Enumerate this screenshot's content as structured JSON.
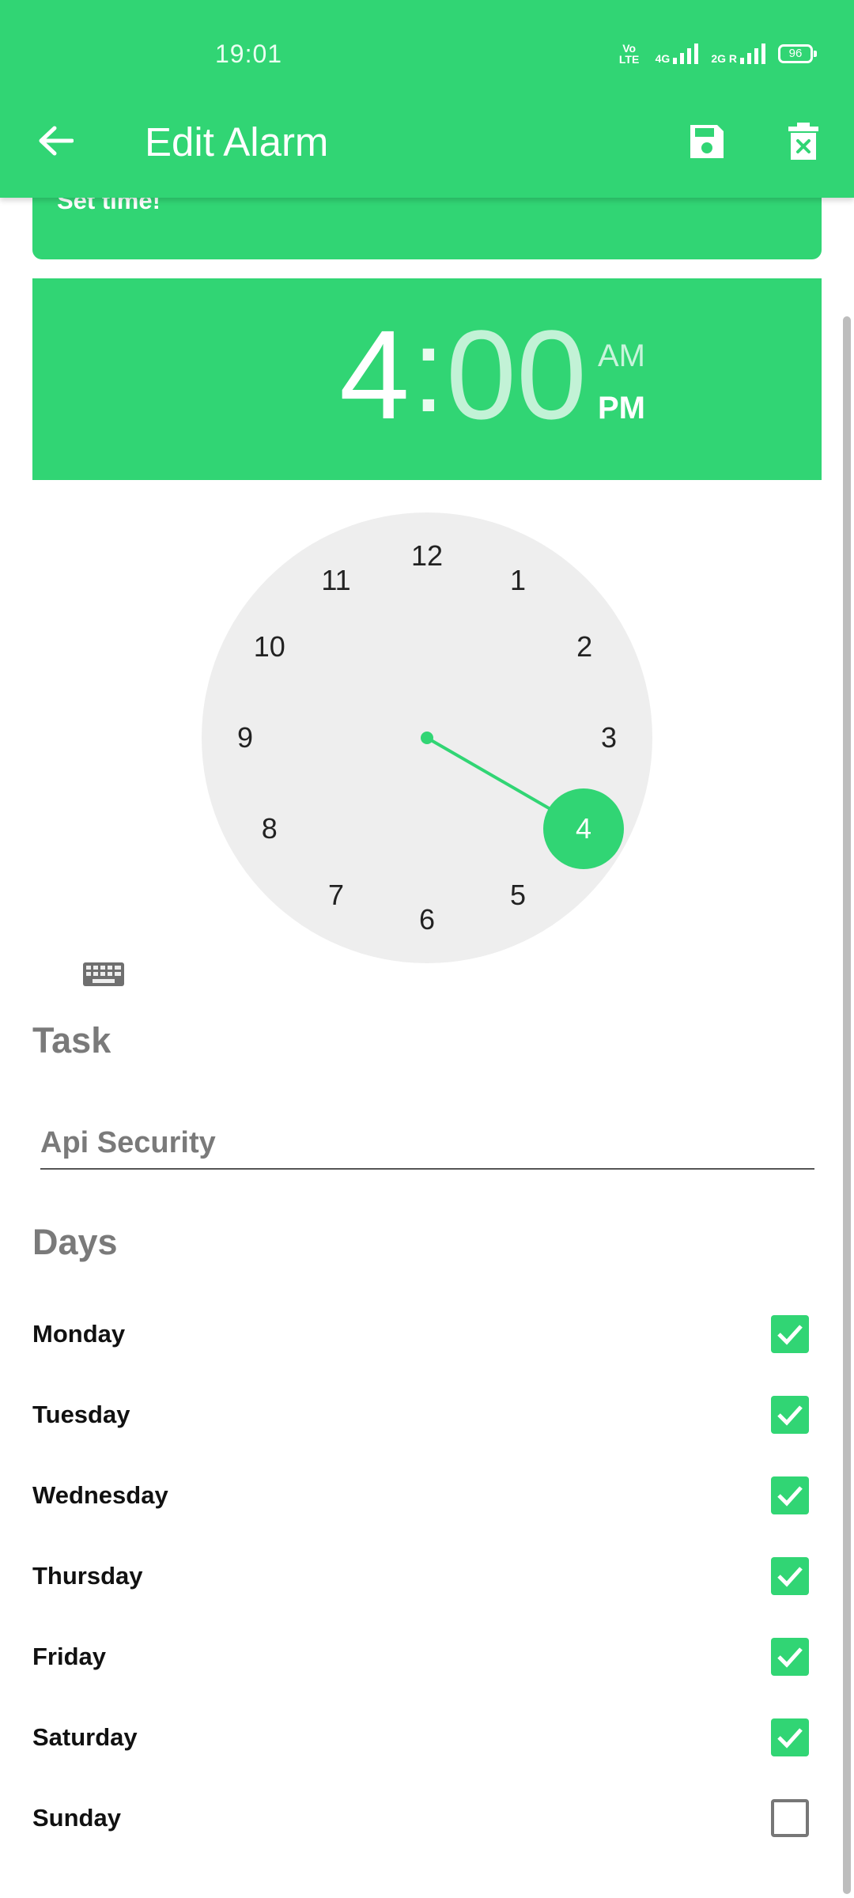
{
  "status_bar": {
    "time": "19:01",
    "volte": "Vo LTE",
    "net1": "4G",
    "net2": "2G R",
    "battery": "96"
  },
  "header": {
    "title": "Edit Alarm",
    "back_icon": "arrow-left-icon",
    "save_icon": "floppy-disk-icon",
    "delete_icon": "trash-x-icon"
  },
  "set_time_text": "Set time!",
  "time": {
    "hour": "4",
    "colon": ":",
    "minute": "00",
    "am": "AM",
    "pm": "PM",
    "selected_period": "PM"
  },
  "clock": {
    "numbers": [
      "12",
      "1",
      "2",
      "3",
      "4",
      "5",
      "6",
      "7",
      "8",
      "9",
      "10",
      "11"
    ],
    "selected": "4",
    "accent": "#31d574"
  },
  "keyboard_icon": "keyboard-icon",
  "task": {
    "label": "Task",
    "value": "Api Security"
  },
  "days": {
    "label": "Days",
    "items": [
      {
        "name": "Monday",
        "checked": true
      },
      {
        "name": "Tuesday",
        "checked": true
      },
      {
        "name": "Wednesday",
        "checked": true
      },
      {
        "name": "Thursday",
        "checked": true
      },
      {
        "name": "Friday",
        "checked": true
      },
      {
        "name": "Saturday",
        "checked": true
      },
      {
        "name": "Sunday",
        "checked": false
      }
    ]
  },
  "colors": {
    "primary": "#31d574",
    "dial": "#eeeeee",
    "label_gray": "#7a7a7a"
  }
}
